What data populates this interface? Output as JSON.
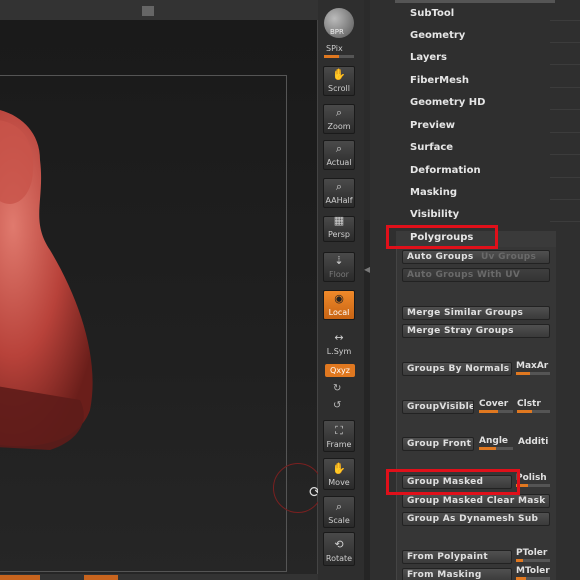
{
  "toolbar": {
    "bpr": "BPR",
    "spix": "SPix",
    "buttons": {
      "scroll": "Scroll",
      "zoom": "Zoom",
      "actual": "Actual",
      "aahalf": "AAHalf",
      "persp": "Persp",
      "floor": "Floor",
      "local": "Local",
      "lsym": "L.Sym",
      "xyz": "Qxyz",
      "frame": "Frame",
      "move": "Move",
      "scale": "Scale",
      "rotate": "Rotate"
    }
  },
  "tool_menu": {
    "items": [
      "SubTool",
      "Geometry",
      "Layers",
      "FiberMesh",
      "Geometry HD",
      "Preview",
      "Surface",
      "Deformation",
      "Masking",
      "Visibility"
    ]
  },
  "polygroups": {
    "title": "Polygroups",
    "auto_groups": "Auto Groups",
    "uv_groups": "Uv Groups",
    "auto_groups_uv": "Auto Groups With UV",
    "merge_similar": "Merge Similar Groups",
    "merge_stray": "Merge Stray Groups",
    "groups_by_normals": "Groups By Normals",
    "maxangle": "MaxAr",
    "group_visible": "GroupVisible",
    "coverage": "Cover",
    "clustering": "Clstr",
    "group_front": "Group Front",
    "angle": "Angle",
    "additive": "Additi",
    "group_masked": "Group Masked",
    "polish": "Polish",
    "group_masked_clear": "Group Masked Clear Mask",
    "group_as_dynamesh": "Group As Dynamesh Sub",
    "from_polypaint": "From Polypaint",
    "ptolerance": "PToler",
    "from_masking": "From Masking",
    "mtolerance": "MToler",
    "maxangle_level": 0.4,
    "coverage_level": 0.55,
    "clustering_level": 0.45,
    "angle_level": 0.5,
    "polish_level": 0.35,
    "ptolerance_level": 0.2,
    "mtolerance_level": 0.3
  },
  "colors": {
    "accent": "#e07820",
    "highlight": "#e0101a",
    "model": "#b8423a"
  },
  "icons": [
    "sphere-icon",
    "hand-icon",
    "magnifier-icon",
    "grid-icon",
    "floor-icon",
    "pivot-icon",
    "symmetry-icon",
    "rotate-icon",
    "frame-icon",
    "move-icon",
    "scale-icon",
    "cursor-rotate-icon"
  ]
}
